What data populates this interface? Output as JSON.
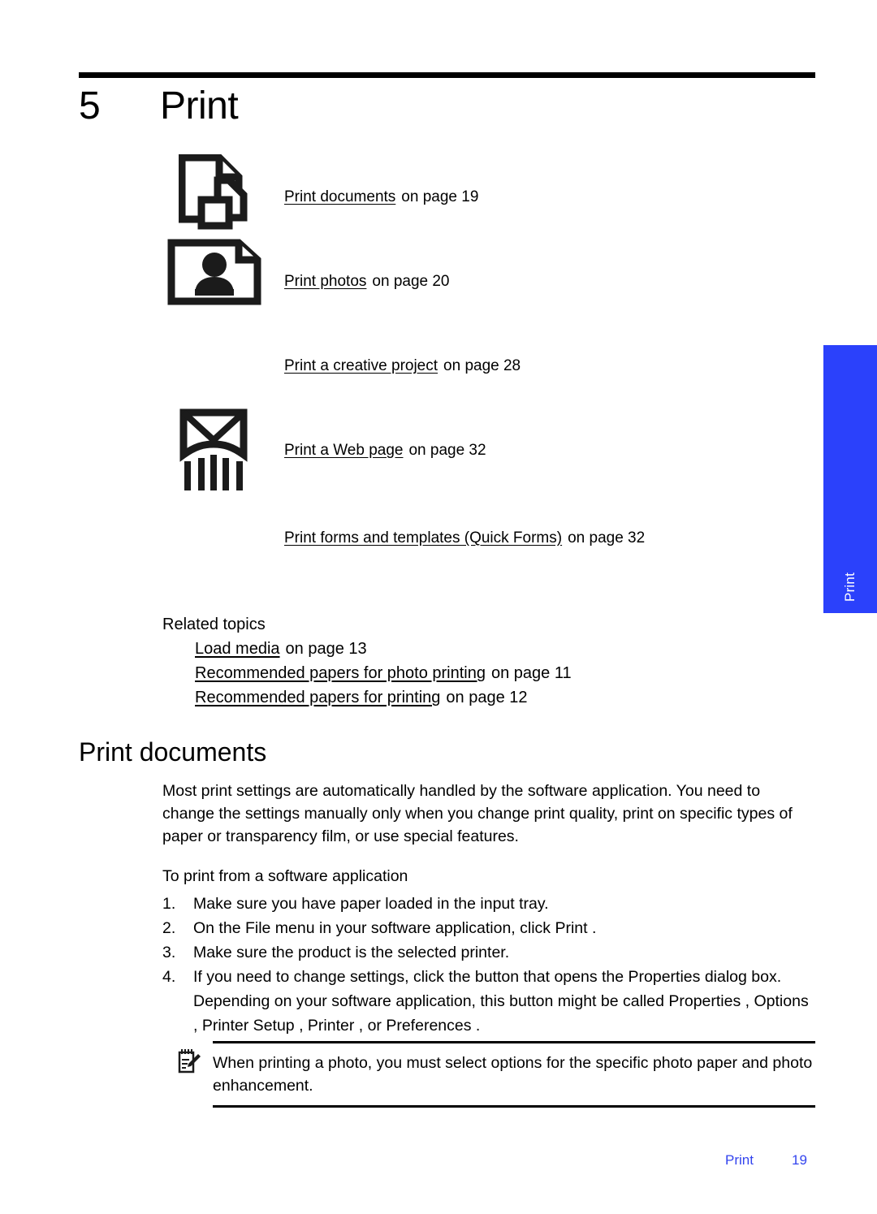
{
  "chapter": {
    "number": "5",
    "title": "Print"
  },
  "side_tab": {
    "label": "Print",
    "color": "#2b41fb"
  },
  "links": [
    {
      "icon": "documents-icon",
      "link_text": "Print documents",
      "suffix": "on page 19"
    },
    {
      "icon": "photo-icon",
      "link_text": "Print photos",
      "suffix": "on page 20"
    },
    {
      "icon": "none",
      "link_text": "Print a creative project",
      "suffix": "on page 28"
    },
    {
      "icon": "web-page-icon",
      "link_text": "Print a Web page",
      "suffix": "on page 32"
    },
    {
      "icon": "none",
      "link_text": "Print forms and templates (Quick Forms)",
      "suffix": "on page 32"
    }
  ],
  "related": {
    "title": "Related topics",
    "items": [
      {
        "link_text": "Load media",
        "suffix": "on page 13"
      },
      {
        "link_text": "Recommended papers for photo printing",
        "suffix": "on page 11"
      },
      {
        "link_text": "Recommended papers for printing",
        "suffix": "on page 12"
      }
    ]
  },
  "section": {
    "heading": "Print documents",
    "body": "Most print settings are automatically handled by the software application. You need to change the settings manually only when you change print quality, print on specific types of paper or transparency film, or use special features.",
    "procedure_title": "To print from a software application",
    "steps": [
      {
        "num": "1.",
        "text": "Make sure you have paper loaded in the input tray."
      },
      {
        "num": "2.",
        "text": "On the File menu in your software application, click Print ."
      },
      {
        "num": "3.",
        "text": "Make sure the product is the selected printer."
      },
      {
        "num": "4.",
        "text": "If you need to change settings, click the button that opens the Properties  dialog box. Depending on your software application, this button might be called Properties , Options , Printer Setup , Printer , or Preferences ."
      }
    ]
  },
  "note": {
    "icon": "note-pencil-icon",
    "text": "When printing a photo, you must select options for the specific photo paper and photo enhancement."
  },
  "footer": {
    "label": "Print",
    "page": "19",
    "color": "#3344ee"
  }
}
